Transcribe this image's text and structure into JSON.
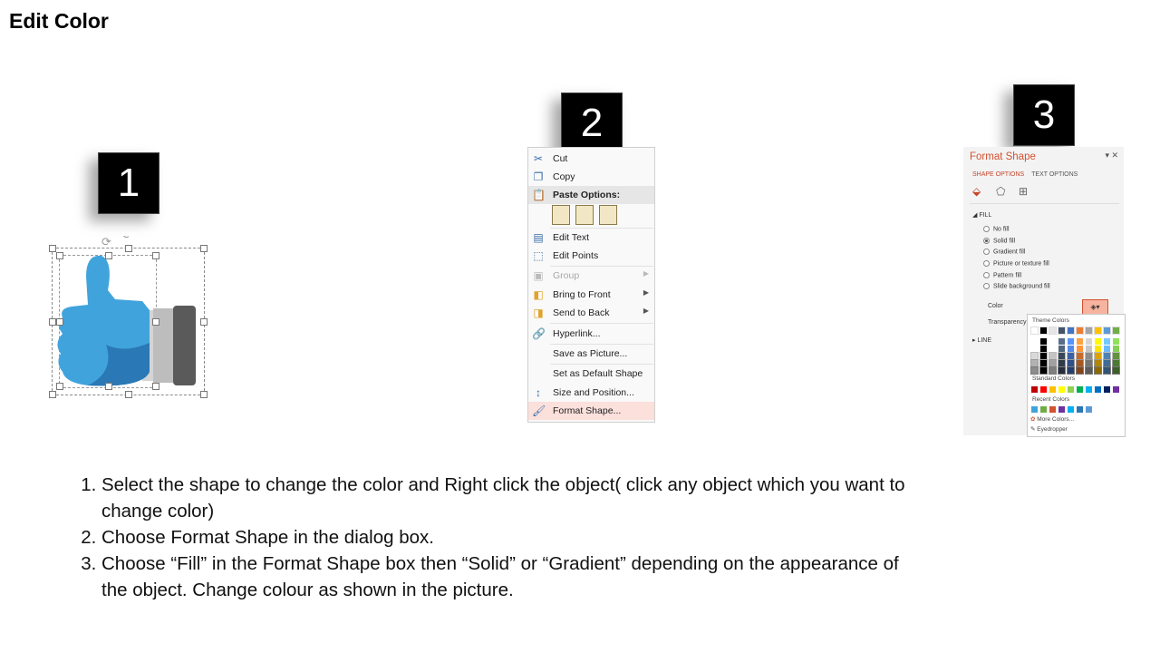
{
  "title": "Edit Color",
  "badges": [
    "1",
    "2",
    "3"
  ],
  "context_menu": {
    "items": [
      {
        "label": "Cut",
        "icon": "scissors-icon"
      },
      {
        "label": "Copy",
        "icon": "copy-icon"
      },
      {
        "label": "Paste Options:",
        "icon": "paste-icon"
      },
      {
        "label": "Edit Text",
        "icon": "edit-text-icon"
      },
      {
        "label": "Edit Points",
        "icon": "edit-points-icon"
      },
      {
        "label": "Group",
        "icon": "group-icon"
      },
      {
        "label": "Bring to Front",
        "icon": "bring-to-front-icon"
      },
      {
        "label": "Send to Back",
        "icon": "send-to-back-icon"
      },
      {
        "label": "Hyperlink...",
        "icon": "hyperlink-icon"
      },
      {
        "label": "Save as Picture...",
        "icon": ""
      },
      {
        "label": "Set as Default Shape",
        "icon": ""
      },
      {
        "label": "Size and Position...",
        "icon": "size-position-icon"
      },
      {
        "label": "Format Shape...",
        "icon": "format-shape-icon"
      }
    ]
  },
  "format_panel": {
    "title": "Format Shape",
    "tab_shape": "SHAPE OPTIONS",
    "tab_text": "TEXT OPTIONS",
    "section_fill": "FILL",
    "fill_options": [
      "No fill",
      "Solid fill",
      "Gradient fill",
      "Picture or texture fill",
      "Pattern fill",
      "Slide background fill"
    ],
    "selected_fill": "Solid fill",
    "color_label": "Color",
    "transparency_label": "Transparency",
    "section_line": "LINE",
    "palette": {
      "theme_colors": "Theme Colors",
      "standard_colors": "Standard Colors",
      "recent_colors": "Recent Colors",
      "more_colors": "More Colors...",
      "eyedropper": "Eyedropper"
    }
  },
  "instructions": [
    "Select the shape to change the color and Right click the object( click any object which you want to change color)",
    "Choose Format Shape in the dialog box.",
    "Choose “Fill” in the Format Shape box then “Solid” or “Gradient” depending on the appearance of the object. Change colour as shown in the picture."
  ],
  "colors": {
    "thumb_blue": "#41a3dc",
    "thumb_dark_blue": "#2a78b5",
    "cuff_gray": "#d4d4d4",
    "cuff_dark": "#5a5a5a",
    "panel_accent": "#d35230"
  }
}
